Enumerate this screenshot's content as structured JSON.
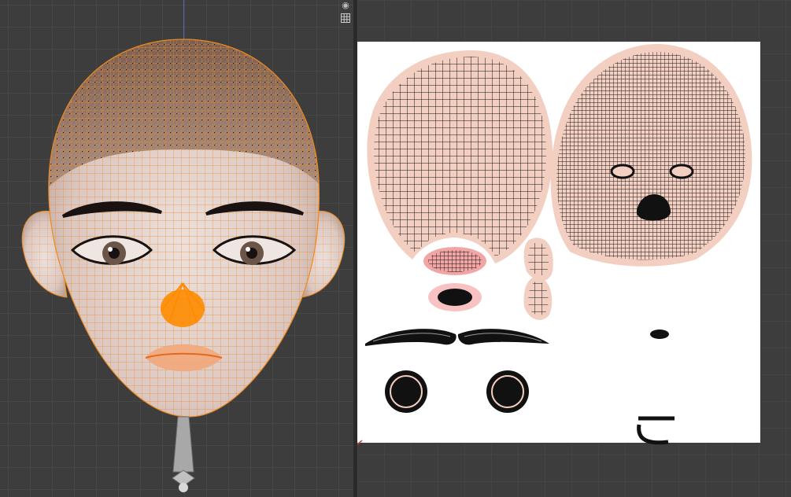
{
  "viewport": {
    "panel": "3d-viewport",
    "icons": [
      "camera-icon",
      "grid-icon"
    ]
  },
  "uv_editor": {
    "panel": "uv-editor"
  },
  "colors": {
    "background": "#3d3d3d",
    "mesh_wire": "#f08a1e",
    "selected_vertex": "#ff8c00",
    "uv_island_fill": "#f3cfc2",
    "uv_wire": "#111111",
    "uv_canvas": "#ffffff",
    "skin": "#e6d2cc"
  }
}
